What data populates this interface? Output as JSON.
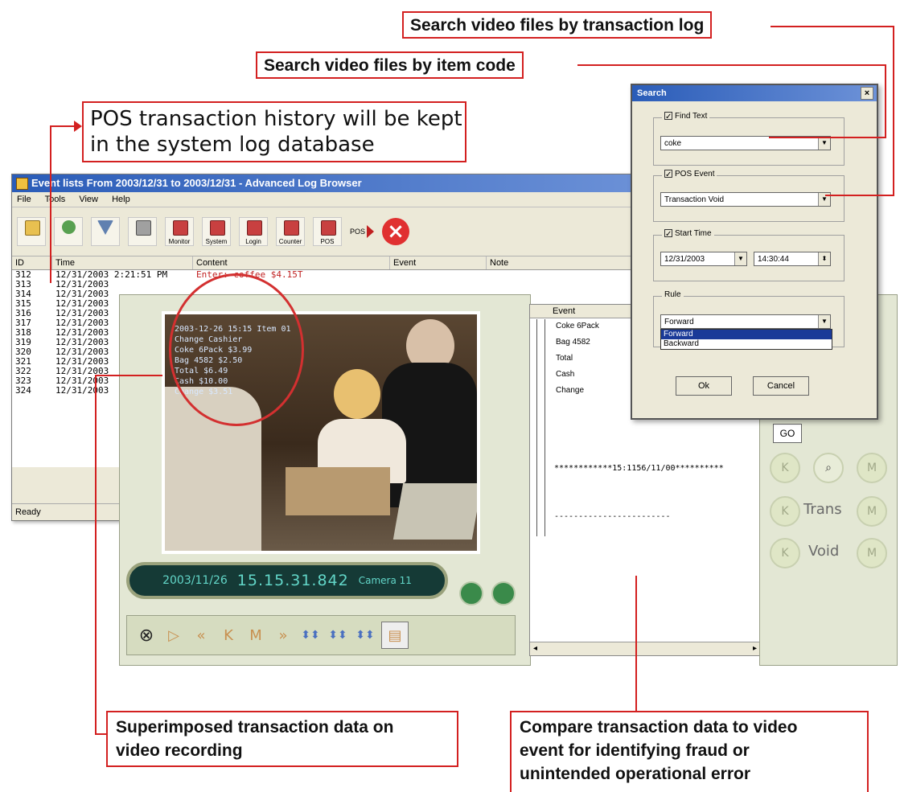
{
  "callouts": {
    "transaction_log": "Search video files by transaction log",
    "item_code": "Search video files by item code",
    "pos_history": [
      "POS transaction history will be kept",
      "in the system log database"
    ],
    "superimposed": [
      "Superimposed transaction data on",
      "video recording"
    ],
    "compare": [
      "Compare transaction data to video",
      "event for identifying fraud or",
      "unintended operational error"
    ]
  },
  "log_window": {
    "title": "Event lists From 2003/12/31 to 2003/12/31 - Advanced Log Browser",
    "menu": [
      "File",
      "Tools",
      "View",
      "Help"
    ],
    "toolbar": {
      "monitor": "Monitor",
      "system": "System",
      "login": "Login",
      "counter": "Counter",
      "pos": "POS",
      "pos_arrow": "POS"
    },
    "columns": [
      "ID",
      "Time",
      "Content",
      "Event",
      "Note"
    ],
    "rows": [
      {
        "id": "312",
        "time": "12/31/2003 2:21:51 PM",
        "content": "Enter: coffee   $4.15T"
      },
      {
        "id": "313",
        "time": "12/31/2003",
        "content": ""
      },
      {
        "id": "314",
        "time": "12/31/2003",
        "content": ""
      },
      {
        "id": "315",
        "time": "12/31/2003",
        "content": ""
      },
      {
        "id": "316",
        "time": "12/31/2003",
        "content": ""
      },
      {
        "id": "317",
        "time": "12/31/2003",
        "content": ""
      },
      {
        "id": "318",
        "time": "12/31/2003",
        "content": ""
      },
      {
        "id": "319",
        "time": "12/31/2003",
        "content": ""
      },
      {
        "id": "320",
        "time": "12/31/2003",
        "content": ""
      },
      {
        "id": "321",
        "time": "12/31/2003",
        "content": ""
      },
      {
        "id": "322",
        "time": "12/31/2003",
        "content": ""
      },
      {
        "id": "323",
        "time": "12/31/2003",
        "content": ""
      },
      {
        "id": "324",
        "time": "12/31/2003",
        "content": ""
      }
    ],
    "status": "Ready"
  },
  "video_overlay": {
    "lines": [
      "2003-12-26   15:15 Item 01",
      "Change    Cashier",
      "Coke 6Pack  $3.99",
      "Bag 4582   $2.50",
      "Total      $6.49",
      "Cash      $10.00",
      "Change     $3.51"
    ]
  },
  "player": {
    "date": "2003/11/26",
    "time": "15.15.31.842",
    "camera": "Camera 11"
  },
  "event_panel": {
    "header": "Event",
    "items": [
      "Coke 6Pack",
      "Bag 4582",
      "Total",
      "Cash",
      "Change"
    ],
    "stars_line": "************15:1156/11/00**********",
    "dashes_line": "------------------------"
  },
  "right_panel": {
    "go": "GO",
    "trans": "Trans",
    "void": "Void"
  },
  "search_dialog": {
    "title": "Search",
    "find_text_label": "Find Text",
    "find_text_value": "coke",
    "pos_event_label": "POS Event",
    "pos_event_value": "Transaction Void",
    "start_time_label": "Start Time",
    "start_date_value": "12/31/2003",
    "start_time_value": "14:30:44",
    "rule_label": "Rule",
    "rule_value": "Forward",
    "rule_options": [
      "Forward",
      "Backward"
    ],
    "ok": "Ok",
    "cancel": "Cancel"
  },
  "colors": {
    "callout_border": "#d32020",
    "titlebar": "#2a5cb8",
    "timepill_bg": "#153a36",
    "timepill_text": "#62d6c8",
    "player_bg": "#e3e7d4"
  }
}
